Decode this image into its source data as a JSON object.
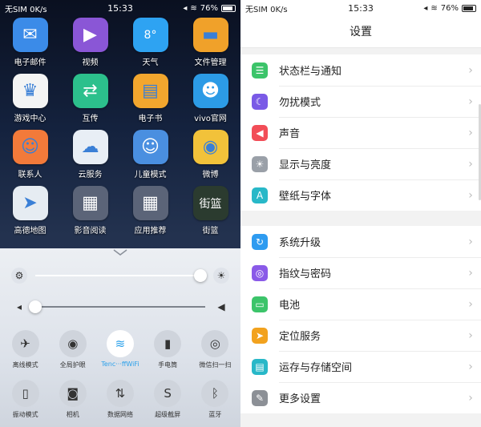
{
  "left_phone": {
    "status": {
      "carrier": "无SIM 0K/s",
      "time": "15:33",
      "battery": "76%"
    },
    "apps": [
      {
        "label": "电子邮件",
        "icon": "mail-icon",
        "glyph": "✉",
        "color": "#3b8be8"
      },
      {
        "label": "视频",
        "icon": "play-icon",
        "glyph": "▶",
        "color": "#8a56d6"
      },
      {
        "label": "天气",
        "icon": "weather-icon",
        "glyph": "8°",
        "color": "#2ea3f2"
      },
      {
        "label": "文件管理",
        "icon": "folder-icon",
        "glyph": "▬",
        "color": "#f0a12a"
      },
      {
        "label": "游戏中心",
        "icon": "game-crown-icon",
        "glyph": "♛",
        "color": "#f4f4f4"
      },
      {
        "label": "互传",
        "icon": "transfer-icon",
        "glyph": "⇄",
        "color": "#2cc08c"
      },
      {
        "label": "电子书",
        "icon": "book-icon",
        "glyph": "▤",
        "color": "#f2a62e"
      },
      {
        "label": "vivo官网",
        "icon": "vivo-mascot-icon",
        "glyph": "☻",
        "color": "#2c9be6"
      },
      {
        "label": "联系人",
        "icon": "contacts-icon",
        "glyph": "☺",
        "color": "#f27a3a"
      },
      {
        "label": "云服务",
        "icon": "cloud-icon",
        "glyph": "☁",
        "color": "#e8eef5"
      },
      {
        "label": "儿童模式",
        "icon": "kid-face-icon",
        "glyph": "☺",
        "color": "#4a8fe0"
      },
      {
        "label": "微博",
        "icon": "weibo-icon",
        "glyph": "◉",
        "color": "#f2c23a"
      },
      {
        "label": "高德地图",
        "icon": "map-arrow-icon",
        "glyph": "➤",
        "color": "#e6ecf2"
      },
      {
        "label": "影音阅读",
        "icon": "folder-media-icon",
        "glyph": "▦",
        "color": "#5b6478"
      },
      {
        "label": "应用推荐",
        "icon": "folder-apps-icon",
        "glyph": "▦",
        "color": "#5b6478"
      },
      {
        "label": "街篮",
        "icon": "street-basketball-icon",
        "glyph": "街篮",
        "color": "#2b3b2f"
      }
    ],
    "control_center": {
      "brightness": {
        "level": 0.97
      },
      "volume": {
        "level": 0.0
      },
      "toggles_row1": [
        {
          "label": "离线模式",
          "icon": "airplane-icon",
          "glyph": "✈",
          "active": false
        },
        {
          "label": "全局护眼",
          "icon": "eye-icon",
          "glyph": "◉",
          "active": false
        },
        {
          "label": "Tenc···ffWiFi",
          "icon": "wifi-icon",
          "glyph": "≋",
          "active": true
        },
        {
          "label": "手电筒",
          "icon": "flashlight-icon",
          "glyph": "▮",
          "active": false
        },
        {
          "label": "微信扫一扫",
          "icon": "wechat-scan-icon",
          "glyph": "◎",
          "active": false
        }
      ],
      "toggles_row2": [
        {
          "label": "振动模式",
          "icon": "vibrate-icon",
          "glyph": "▯",
          "active": false
        },
        {
          "label": "相机",
          "icon": "camera-icon",
          "glyph": "◙",
          "active": false
        },
        {
          "label": "数据网络",
          "icon": "data-network-icon",
          "glyph": "⇅",
          "active": false
        },
        {
          "label": "超级截屏",
          "icon": "screenshot-icon",
          "glyph": "S",
          "active": false
        },
        {
          "label": "蓝牙",
          "icon": "bluetooth-icon",
          "glyph": "ᛒ",
          "active": false
        }
      ]
    }
  },
  "right_phone": {
    "status": {
      "carrier": "无SIM 0K/s",
      "time": "15:33",
      "battery": "76%"
    },
    "title": "设置",
    "groups": [
      [
        {
          "label": "状态栏与通知",
          "icon": "statusbar-icon",
          "glyph": "☰",
          "color": "#3cc46a"
        },
        {
          "label": "勿扰模式",
          "icon": "moon-icon",
          "glyph": "☾",
          "color": "#7a5ae6"
        },
        {
          "label": "声音",
          "icon": "speaker-icon",
          "glyph": "◀",
          "color": "#f24d57"
        },
        {
          "label": "显示与亮度",
          "icon": "brightness-icon",
          "glyph": "☀",
          "color": "#9aa0a8"
        },
        {
          "label": "壁纸与字体",
          "icon": "font-icon",
          "glyph": "A",
          "color": "#28b8c8"
        }
      ],
      [
        {
          "label": "系统升级",
          "icon": "system-upgrade-icon",
          "glyph": "↻",
          "color": "#2e9bf0"
        },
        {
          "label": "指纹与密码",
          "icon": "fingerprint-icon",
          "glyph": "◎",
          "color": "#8a5ae8"
        },
        {
          "label": "电池",
          "icon": "battery-icon",
          "glyph": "▭",
          "color": "#3cc46a"
        },
        {
          "label": "定位服务",
          "icon": "location-icon",
          "glyph": "➤",
          "color": "#f2a21e"
        },
        {
          "label": "运存与存储空间",
          "icon": "storage-icon",
          "glyph": "▤",
          "color": "#28b8c8"
        },
        {
          "label": "更多设置",
          "icon": "wrench-icon",
          "glyph": "✎",
          "color": "#8c9096"
        }
      ]
    ]
  }
}
